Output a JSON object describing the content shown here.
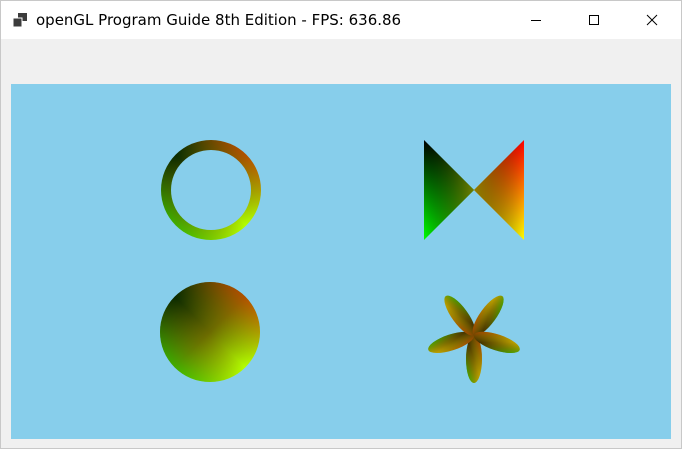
{
  "window": {
    "title": "openGL Program Guide 8th Edition - FPS: 636.86",
    "icons": {
      "app": "app-window-icon",
      "minimize": "minimize-icon",
      "maximize": "maximize-icon",
      "close": "close-icon"
    }
  },
  "viewport": {
    "background_color": "#87ceeb",
    "shapes": [
      "ring",
      "bowtie",
      "disc",
      "flower"
    ],
    "colors": {
      "red": "#ff0000",
      "dark": "#000000",
      "green": "#00ff00",
      "yellow": "#ffff00"
    }
  }
}
